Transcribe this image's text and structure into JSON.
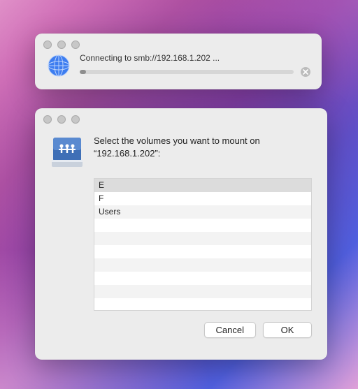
{
  "progress_window": {
    "status_text": "Connecting to smb://192.168.1.202 ..."
  },
  "mount_window": {
    "prompt": "Select the volumes you want to mount on “192.168.1.202”:",
    "volumes": {
      "0": "E",
      "1": "F",
      "2": "Users"
    },
    "buttons": {
      "cancel": "Cancel",
      "ok": "OK"
    }
  }
}
